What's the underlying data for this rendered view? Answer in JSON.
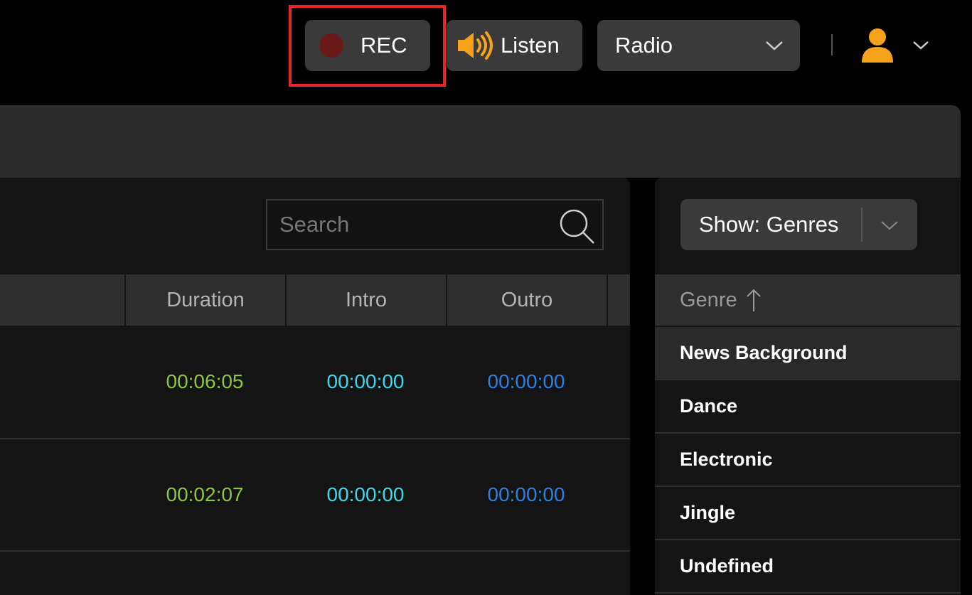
{
  "header": {
    "rec_label": "REC",
    "listen_label": "Listen",
    "station_select_value": "Radio",
    "icons": [
      "record-dot-icon",
      "speaker-icon",
      "chevron-down-icon",
      "user-icon"
    ],
    "accent_orange": "#f7a21b",
    "highlight_color": "#e8262a"
  },
  "tracks": {
    "search_placeholder": "Search",
    "columns": [
      "",
      "Duration",
      "Intro",
      "Outro"
    ],
    "rows": [
      {
        "duration": "00:06:05",
        "intro": "00:00:00",
        "outro": "00:00:00"
      },
      {
        "duration": "00:02:07",
        "intro": "00:00:00",
        "outro": "00:00:00"
      }
    ],
    "colors": {
      "duration": "#8dc63f",
      "intro": "#3ed8e8",
      "outro": "#2f7fe0"
    }
  },
  "genres": {
    "show_select_value": "Show: Genres",
    "column_header": "Genre",
    "items": [
      "News Background",
      "Dance",
      "Electronic",
      "Jingle",
      "Undefined"
    ]
  }
}
